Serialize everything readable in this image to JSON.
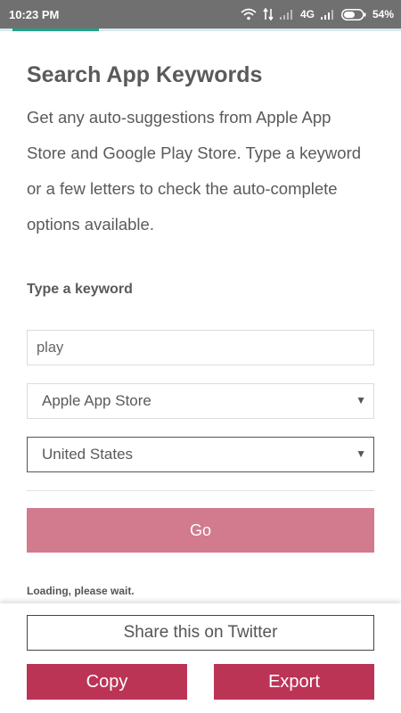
{
  "status_bar": {
    "time": "10:23 PM",
    "network": "4G",
    "battery": "54%",
    "icons": [
      "wifi-icon",
      "data-transfer-icon",
      "signal-icon",
      "signal-icon",
      "battery-icon"
    ]
  },
  "page": {
    "title": "Search App Keywords",
    "description": "Get any auto-suggestions from Apple App Store and Google Play Store. Type a keyword or a few letters to check the auto-complete options available."
  },
  "form": {
    "keyword_label": "Type a keyword",
    "keyword_value": "play",
    "store_selected": "Apple App Store",
    "country_selected": "United States",
    "go_label": "Go",
    "loading_text": "Loading, please wait."
  },
  "bottom": {
    "share_label": "Share this on Twitter",
    "copy_label": "Copy",
    "export_label": "Export"
  },
  "colors": {
    "accent": "#20a38c",
    "go_button": "#d27a8e",
    "action_button": "#bb3456",
    "status_bar": "#707070"
  }
}
